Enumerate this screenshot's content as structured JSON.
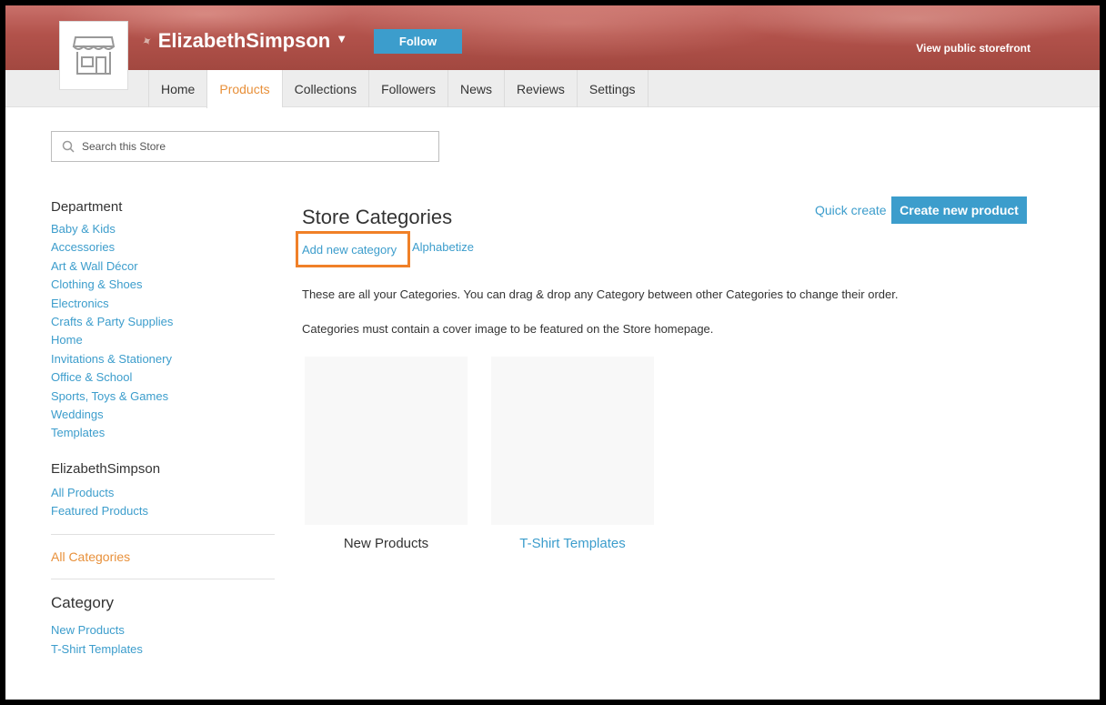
{
  "header": {
    "store_name": "ElizabethSimpson",
    "follow_label": "Follow",
    "public_link": "View public storefront"
  },
  "tabs": [
    {
      "label": "Home",
      "active": false
    },
    {
      "label": "Products",
      "active": true
    },
    {
      "label": "Collections",
      "active": false
    },
    {
      "label": "Followers",
      "active": false
    },
    {
      "label": "News",
      "active": false
    },
    {
      "label": "Reviews",
      "active": false
    },
    {
      "label": "Settings",
      "active": false
    }
  ],
  "search": {
    "placeholder": "Search this Store",
    "value": ""
  },
  "sidebar": {
    "departments_heading": "Department",
    "departments": [
      "Baby & Kids",
      "Accessories",
      "Art & Wall Décor",
      "Clothing & Shoes",
      "Electronics",
      "Crafts & Party Supplies",
      "Home",
      "Invitations & Stationery",
      "Office & School",
      "Sports, Toys & Games",
      "Weddings",
      "Templates"
    ],
    "store_heading": "ElizabethSimpson",
    "store_links": [
      "All Products",
      "Featured Products"
    ],
    "all_categories": "All Categories",
    "category_heading": "Category",
    "category_links": [
      "New Products",
      "T-Shirt Templates"
    ]
  },
  "main": {
    "title": "Store Categories",
    "quick_create": "Quick create",
    "create_button": "Create new product",
    "add_category": "Add new category",
    "alphabetize": "Alphabetize",
    "info1": "These are all your Categories. You can drag & drop any Category between other Categories to change their order.",
    "info2": "Categories must contain a cover image to be featured on the Store homepage.",
    "cards": [
      {
        "label": "New Products"
      },
      {
        "label": "T-Shirt Templates"
      }
    ]
  },
  "colors": {
    "accent_blue": "#3c9dcc",
    "accent_orange": "#e8903a",
    "highlight_box": "#f08028"
  }
}
